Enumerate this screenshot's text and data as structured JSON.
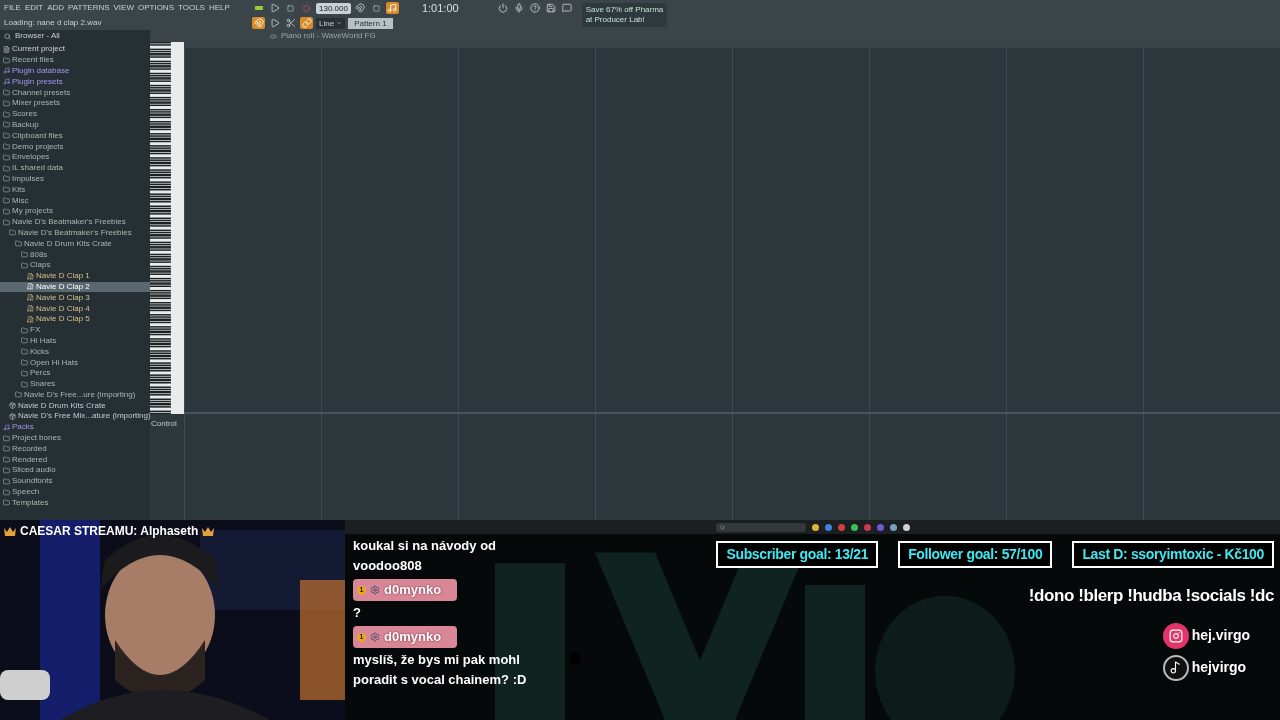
{
  "menu": [
    "FILE",
    "EDIT",
    "ADD",
    "PATTERNS",
    "VIEW",
    "OPTIONS",
    "TOOLS",
    "HELP"
  ],
  "status": "Loading: nane d clap 2.wav",
  "tempo": "130.000",
  "time": "1:01:00",
  "snap": "Line",
  "pattern": "Pattern 1",
  "promo": [
    "Save 67% off Pharma",
    "at Producer Lab!"
  ],
  "browser": {
    "title": "Browser - All",
    "items": [
      {
        "label": "Current project",
        "kind": "file",
        "selected": false
      },
      {
        "label": "Recent files",
        "kind": "folder",
        "selected": false
      },
      {
        "label": "Plugin database",
        "kind": "plugin",
        "selected": false
      },
      {
        "label": "Plugin presets",
        "kind": "plugin",
        "selected": false
      },
      {
        "label": "Channel presets",
        "kind": "folder",
        "selected": false
      },
      {
        "label": "Mixer presets",
        "kind": "folder",
        "selected": false
      },
      {
        "label": "Scores",
        "kind": "folder",
        "selected": false
      },
      {
        "label": "Backup",
        "kind": "folder",
        "selected": false
      },
      {
        "label": "Clipboard files",
        "kind": "folder",
        "selected": false
      },
      {
        "label": "Demo projects",
        "kind": "folder",
        "selected": false
      },
      {
        "label": "Envelopes",
        "kind": "folder",
        "selected": false
      },
      {
        "label": "IL shared data",
        "kind": "folder",
        "selected": false
      },
      {
        "label": "Impulses",
        "kind": "folder",
        "selected": false
      },
      {
        "label": "Kits",
        "kind": "folder",
        "selected": false
      },
      {
        "label": "Misc",
        "kind": "folder",
        "selected": false
      },
      {
        "label": "My projects",
        "kind": "folder",
        "selected": false
      },
      {
        "label": "Navie D's Beatmaker's Freebies",
        "kind": "folder",
        "selected": false,
        "children": [
          {
            "label": "Navie D's Beatmaker's Freebies",
            "kind": "folder",
            "selected": false,
            "children": [
              {
                "label": "Navie D Drum Kits Crate",
                "kind": "folder",
                "selected": false,
                "children": [
                  {
                    "label": "808s",
                    "kind": "folder",
                    "selected": false
                  },
                  {
                    "label": "Claps",
                    "kind": "folder",
                    "selected": false,
                    "children": [
                      {
                        "label": "Navie D Clap 1",
                        "kind": "audio",
                        "selected": false
                      },
                      {
                        "label": "Navie D Clap 2",
                        "kind": "audio",
                        "selected": true
                      },
                      {
                        "label": "Navie D Clap 3",
                        "kind": "audio",
                        "selected": false
                      },
                      {
                        "label": "Navie D Clap 4",
                        "kind": "audio",
                        "selected": false
                      },
                      {
                        "label": "Navie D Clap 5",
                        "kind": "audio",
                        "selected": false
                      }
                    ]
                  },
                  {
                    "label": "FX",
                    "kind": "folder",
                    "selected": false
                  },
                  {
                    "label": "Hi Hats",
                    "kind": "folder",
                    "selected": false
                  },
                  {
                    "label": "Kicks",
                    "kind": "folder",
                    "selected": false
                  },
                  {
                    "label": "Open Hi Hats",
                    "kind": "folder",
                    "selected": false
                  },
                  {
                    "label": "Percs",
                    "kind": "folder",
                    "selected": false
                  },
                  {
                    "label": "Snares",
                    "kind": "folder",
                    "selected": false
                  }
                ]
              },
              {
                "label": "Navie D's Free...ure (importing)",
                "kind": "folder",
                "selected": false
              }
            ]
          },
          {
            "label": "Navie D Drum Kits Crate",
            "kind": "archive",
            "selected": false
          },
          {
            "label": "Navie D's Free Mix...ature (importing)",
            "kind": "archive",
            "selected": false
          }
        ]
      },
      {
        "label": "Packs",
        "kind": "plugin",
        "selected": false
      },
      {
        "label": "Project bones",
        "kind": "folder",
        "selected": false
      },
      {
        "label": "Recorded",
        "kind": "folder",
        "selected": false
      },
      {
        "label": "Rendered",
        "kind": "folder",
        "selected": false
      },
      {
        "label": "Sliced audio",
        "kind": "folder",
        "selected": false
      },
      {
        "label": "Soundfonts",
        "kind": "folder",
        "selected": false
      },
      {
        "label": "Speech",
        "kind": "folder",
        "selected": false
      },
      {
        "label": "Templates",
        "kind": "folder",
        "selected": false
      }
    ]
  },
  "piano_roll": {
    "title": "Piano roll - WaveWorld FG",
    "event_label": "Control"
  },
  "banner": "CAESAR STREAMU: Alphaseth",
  "chat": [
    {
      "text": "koukal si na návody od voodoo808"
    },
    {
      "user": "d0mynko",
      "badge": "1",
      "text": "?"
    },
    {
      "user": "d0mynko",
      "badge": "1",
      "text": "myslíš, že bys mi pak mohl poradit s vocal chainem? :D"
    }
  ],
  "goals": [
    "Subscriber goal: 13/21",
    "Follower goal: 57/100",
    "Last D: ssoryimtoxic - Kč100"
  ],
  "commands": "!dono !blerp !hudba !socials !dc",
  "socials": [
    {
      "kind": "instagram",
      "handle": "hej.virgo"
    },
    {
      "kind": "tiktok",
      "handle": "hejvirgo"
    }
  ]
}
